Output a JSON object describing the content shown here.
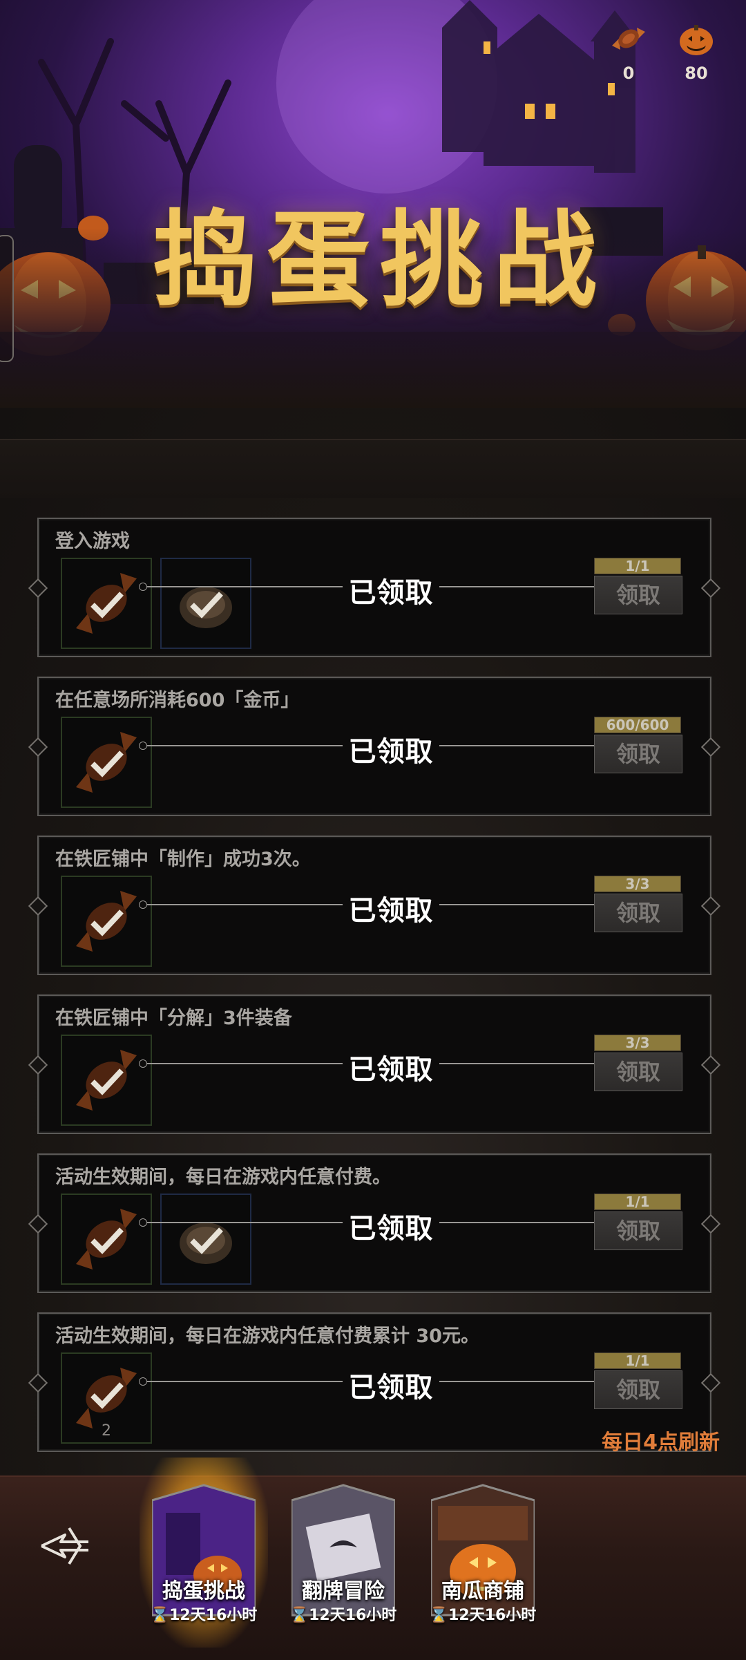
{
  "banner": {
    "title": "捣蛋挑战",
    "currencies": [
      {
        "icon": "candy-icon",
        "value": "0"
      },
      {
        "icon": "pumpkin-icon",
        "value": "80"
      }
    ]
  },
  "tasks": [
    {
      "title": "登入游戏",
      "rewards": [
        "candy-icon",
        "coin-pouch-icon"
      ],
      "status": "已领取",
      "progress": "1/1",
      "button": "领取"
    },
    {
      "title": "在任意场所消耗600「金币」",
      "rewards": [
        "candy-icon"
      ],
      "status": "已领取",
      "progress": "600/600",
      "button": "领取"
    },
    {
      "title": "在铁匠铺中「制作」成功3次。",
      "rewards": [
        "candy-icon"
      ],
      "status": "已领取",
      "progress": "3/3",
      "button": "领取"
    },
    {
      "title": "在铁匠铺中「分解」3件装备",
      "rewards": [
        "candy-icon"
      ],
      "status": "已领取",
      "progress": "3/3",
      "button": "领取"
    },
    {
      "title": "活动生效期间，每日在游戏内任意付费。",
      "rewards": [
        "candy-icon",
        "coin-pouch-icon"
      ],
      "status": "已领取",
      "progress": "1/1",
      "button": "领取"
    },
    {
      "title": "活动生效期间，每日在游戏内任意付费累计 30元。",
      "rewards": [
        "candy-icon"
      ],
      "reward_count": "2",
      "status": "已领取",
      "progress": "1/1",
      "button": "领取"
    }
  ],
  "refresh_note": "每日4点刷新",
  "bottom_nav": {
    "back_icon": "back-arrow-icon",
    "tabs": [
      {
        "label": "捣蛋挑战",
        "timer": "⌛12天16小时",
        "active": true
      },
      {
        "label": "翻牌冒险",
        "timer": "⌛12天16小时",
        "active": false
      },
      {
        "label": "南瓜商铺",
        "timer": "⌛12天16小时",
        "active": false
      }
    ]
  },
  "colors": {
    "accent_gold": "#f1c65f",
    "refresh_orange": "#e17d3a",
    "banner_purple": "#5b2a8f"
  }
}
